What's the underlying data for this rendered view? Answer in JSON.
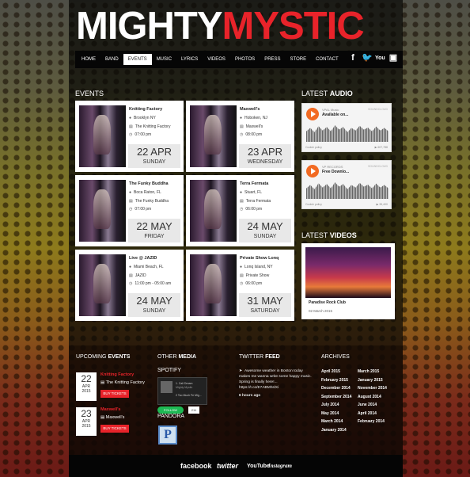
{
  "logo": {
    "white": "MIGHTY",
    "red": "MYSTIC"
  },
  "nav": {
    "items": [
      "HOME",
      "BAND",
      "EVENTS",
      "MUSIC",
      "LYRICS",
      "VIDEOS",
      "PHOTOS",
      "PRESS",
      "STORE",
      "CONTACT"
    ],
    "active": "EVENTS"
  },
  "social_icons": [
    "facebook-icon",
    "twitter-icon",
    "youtube-icon",
    "instagram-icon"
  ],
  "events": {
    "title_plain": "EVENTS",
    "cards": [
      {
        "venue": "Knitting Factory",
        "city": "Brooklyn NY",
        "place": "The Knitting Factory",
        "time": "07:00 pm",
        "date": "22 APR",
        "day": "SUNDAY"
      },
      {
        "venue": "Maxwell's",
        "city": "Hoboken, NJ",
        "place": "Maxwell's",
        "time": "08:00 pm",
        "date": "23 APR",
        "day": "WEDNESDAY"
      },
      {
        "venue": "The Funky Buddha",
        "city": "Boca Raton, FL",
        "place": "The Funky Buddha",
        "time": "07:00 pm",
        "date": "22 MAY",
        "day": "FRIDAY"
      },
      {
        "venue": "Terra Fermata",
        "city": "Stuart, FL",
        "place": "Terra Fermata",
        "time": "06:00 pm",
        "date": "24 MAY",
        "day": "SUNDAY"
      },
      {
        "venue": "Live @ JAZID",
        "city": "Miami Beach, FL",
        "place": "JAZID",
        "time": "11:00 pm - 05:00 am",
        "date": "24 MAY",
        "day": "SUNDAY"
      },
      {
        "venue": "Private Show Lonq",
        "city": "Lonq Island, NY",
        "place": "Private Show",
        "time": "06:00 pm",
        "date": "31 MAY",
        "day": "SATURDAY"
      }
    ]
  },
  "latest_audio": {
    "plain": "LATEST",
    "bold": "AUDIO",
    "tracks": [
      {
        "artist": "VPAL Music",
        "title": "Available on...",
        "cookie": "Cookie policy",
        "plays": "▶ 607,788"
      },
      {
        "artist": "VP RECORDS",
        "title": "Free Downlo...",
        "cookie": "Cookie policy",
        "plays": "▶ 35,400"
      }
    ],
    "soundcloud": "SOUNDCLOUD"
  },
  "latest_videos": {
    "plain": "LATEST",
    "bold": "VIDEOS",
    "caption": "Paradise Rock Club",
    "date": "02 March 2015"
  },
  "upcoming": {
    "plain": "UPCOMING",
    "bold": "EVENTS",
    "items": [
      {
        "day": "22",
        "month": "APR",
        "year": "2015",
        "venue": "Knitting Factory",
        "place": "The Knitting Factory",
        "button": "BUY TICKETS"
      },
      {
        "day": "23",
        "month": "APR",
        "year": "2015",
        "venue": "Maxwell's",
        "place": "Maxwell's",
        "button": "BUY TICKETS"
      }
    ]
  },
  "other_media": {
    "plain": "OTHER",
    "bold": "MEDIA",
    "spotify": "SPOTIFY",
    "pandora": "PANDORA",
    "follow": "FOLLOW",
    "count": "211",
    "track": "1. Cali Dream",
    "artist": "Mighty Mystic",
    "track2": "2 Too Much Fe Mig..."
  },
  "twitter": {
    "plain": "TWITTER",
    "bold": "FEED",
    "text": "Awesome weather in Boston today makes me wanna write some happy music. Spring is finally here!... https://t.co/E7ABMhslXi",
    "ago": "6 hours ago"
  },
  "archives": {
    "title": "ARCHIVES",
    "col1": [
      "April 2015",
      "February 2015",
      "December 2014",
      "September 2014",
      "July 2014",
      "May 2014",
      "March 2014",
      "January 2014"
    ],
    "col2": [
      "March 2015",
      "January 2015",
      "November 2014",
      "August 2014",
      "June 2014",
      "April 2014",
      "February 2014"
    ]
  },
  "footer": [
    "facebook",
    "twitter",
    "YouTube",
    "Instagram"
  ]
}
